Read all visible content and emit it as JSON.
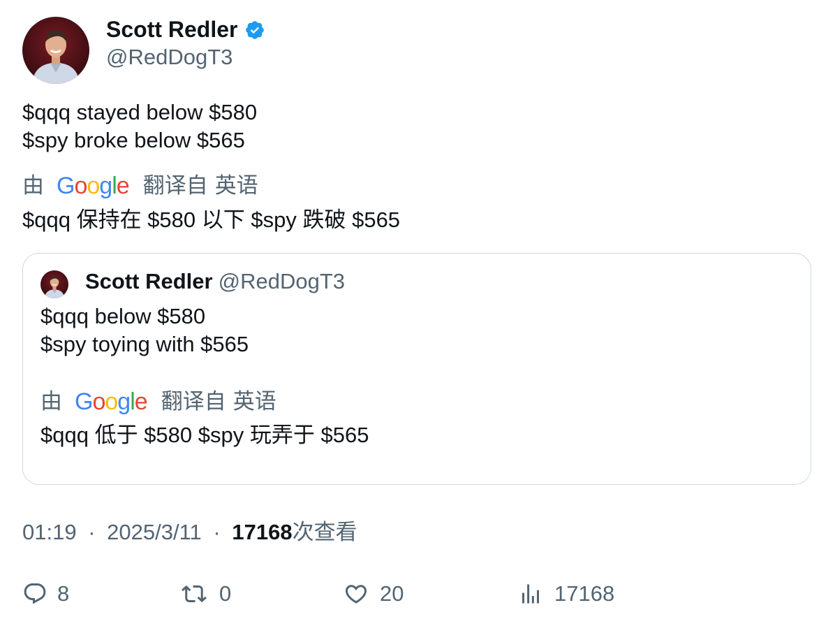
{
  "author": {
    "name": "Scott Redler",
    "handle": "@RedDogT3",
    "avatar_icon": "avatar-photo",
    "verified_icon": "verified-badge-icon",
    "verified_color": "#1d9bf0"
  },
  "tweet": {
    "lines": [
      "$qqq stayed below $580",
      "$spy broke below $565"
    ],
    "translate": {
      "by": "由",
      "provider": "Google",
      "from": "翻译自",
      "language": "英语"
    },
    "translation": "$qqq 保持在 $580 以下 $spy 跌破 $565"
  },
  "quoted": {
    "name": "Scott Redler",
    "handle": "@RedDogT3",
    "lines": [
      "$qqq below $580",
      "$spy toying with $565"
    ],
    "translate": {
      "by": "由",
      "provider": "Google",
      "from": "翻译自",
      "language": "英语"
    },
    "translation": "$qqq 低于 $580 $spy 玩弄于 $565"
  },
  "meta": {
    "time": "01:19",
    "separator": "·",
    "date": "2025/3/11",
    "views": "17168",
    "views_label": "次查看"
  },
  "actions": {
    "replies": "8",
    "retweets": "0",
    "likes": "20",
    "views": "17168"
  },
  "colors": {
    "text": "#0f1419",
    "muted": "#536471",
    "border": "#cfd9de",
    "google_blue": "#4285F4",
    "google_red": "#EA4335",
    "google_yellow": "#FBBC05",
    "google_green": "#34A853"
  }
}
